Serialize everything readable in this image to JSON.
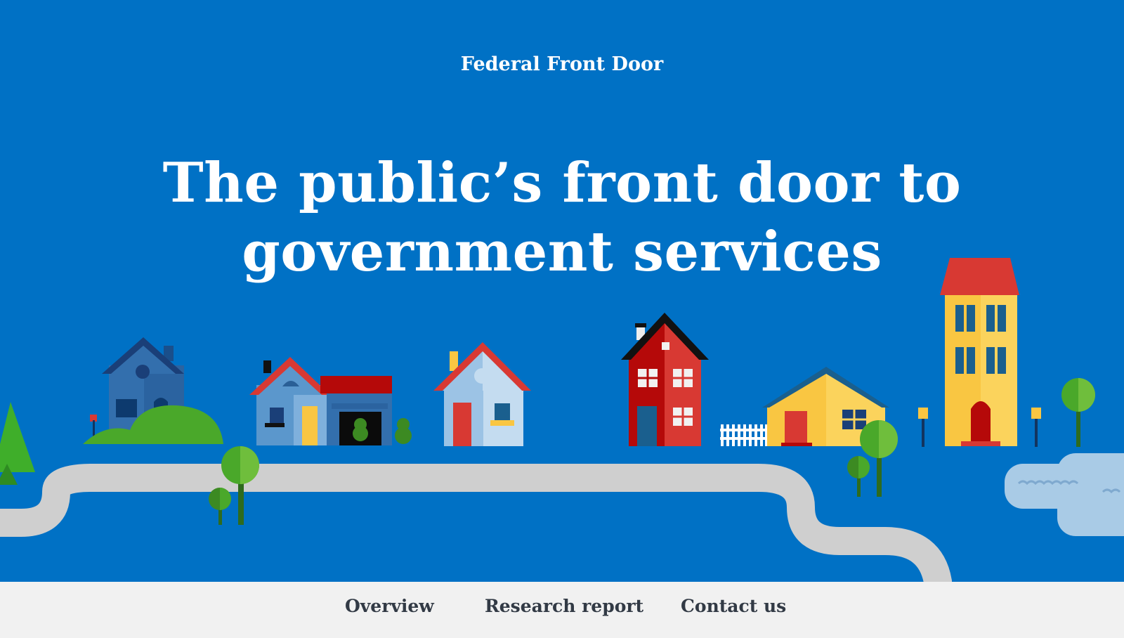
{
  "header": {
    "site_title": "Federal Front Door"
  },
  "hero": {
    "headline_line1": "The public’s front door to",
    "headline_line2": "government services",
    "illustration": "neighborhood-illustration"
  },
  "colors": {
    "hero_blue": "#0071c5",
    "nav_background": "#f1f1f1",
    "nav_text": "#323a45"
  },
  "nav": {
    "items": [
      {
        "label": "Overview"
      },
      {
        "label": "Research report"
      },
      {
        "label": "Contact us"
      }
    ]
  }
}
